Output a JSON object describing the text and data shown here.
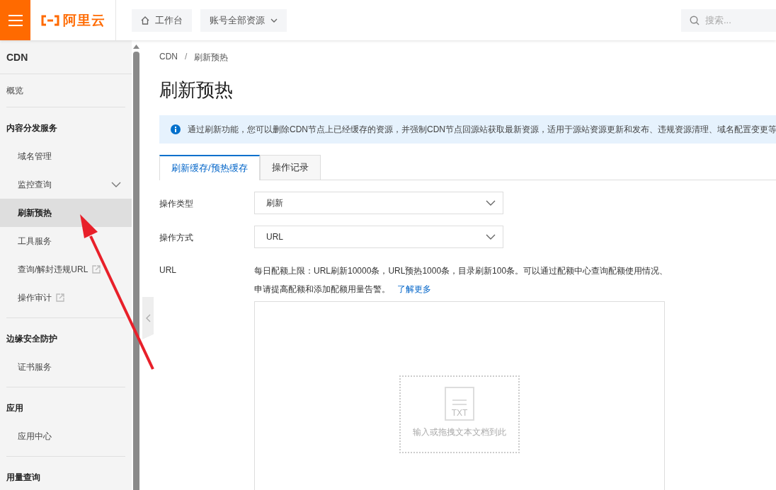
{
  "topbar": {
    "logo_text": "阿里云",
    "buttons": [
      {
        "label": "工作台",
        "kind": "home"
      },
      {
        "label": "账号全部资源",
        "kind": "dropdown"
      }
    ],
    "search": {
      "placeholder": "搜索..."
    }
  },
  "sidebar": {
    "title": "CDN",
    "sections": [
      {
        "items": [
          {
            "label": "概览",
            "kind": "link",
            "selected": false
          }
        ]
      },
      {
        "title": "内容分发服务",
        "items": [
          {
            "label": "域名管理",
            "kind": "link",
            "selected": false
          },
          {
            "label": "监控查询",
            "kind": "submenu",
            "selected": false
          },
          {
            "label": "刷新预热",
            "kind": "link",
            "selected": true
          },
          {
            "label": "工具服务",
            "kind": "link",
            "selected": false
          },
          {
            "label": "查询/解封违规URL",
            "kind": "external",
            "selected": false
          },
          {
            "label": "操作审计",
            "kind": "external",
            "selected": false
          }
        ]
      },
      {
        "title": "边缘安全防护",
        "items": [
          {
            "label": "证书服务",
            "kind": "link",
            "selected": false
          }
        ]
      },
      {
        "title": "应用",
        "items": [
          {
            "label": "应用中心",
            "kind": "link",
            "selected": false
          }
        ]
      },
      {
        "title": "用量查询"
      }
    ]
  },
  "breadcrumb": {
    "items": [
      "CDN",
      "刷新预热"
    ],
    "separator": "/"
  },
  "page_title": "刷新预热",
  "info_alert": "通过刷新功能，您可以删除CDN节点上已经缓存的资源，并强制CDN节点回源站获取最新资源，适用于源站资源更新和发布、违规资源清理、域名配置变更等",
  "tabs": [
    {
      "label": "刷新缓存/预热缓存",
      "selected": true
    },
    {
      "label": "操作记录",
      "selected": false
    }
  ],
  "form": {
    "fields": [
      {
        "label": "操作类型",
        "kind": "select",
        "value": "刷新"
      },
      {
        "label": "操作方式",
        "kind": "select",
        "value": "URL"
      },
      {
        "label": "URL",
        "kind": "textarea",
        "help": "每日配额上限：URL刷新10000条，URL预热1000条，目录刷新100条。可以通过配额中心查询配额使用情况、申请提高配额和添加配额用量告警。",
        "link": "了解更多",
        "drop_icon_text": "TXT",
        "drop_hint": "输入或拖拽文本文档到此"
      }
    ]
  }
}
